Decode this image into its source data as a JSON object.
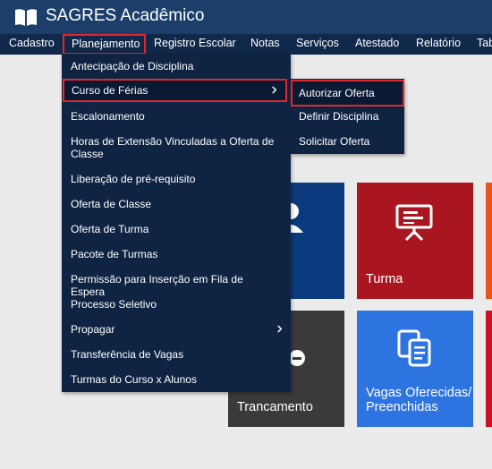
{
  "app": {
    "title": "SAGRES Acadêmico",
    "brand_color": "#1b3f6a"
  },
  "menubar": {
    "items": [
      {
        "label": "Cadastro"
      },
      {
        "label": "Planejamento",
        "highlighted": true
      },
      {
        "label": "Registro Escolar"
      },
      {
        "label": "Notas"
      },
      {
        "label": "Serviços"
      },
      {
        "label": "Atestado"
      },
      {
        "label": "Relatório"
      },
      {
        "label": "Tab"
      }
    ]
  },
  "dropdown": {
    "items": [
      {
        "label": "Antecipação de Disciplina"
      },
      {
        "label": "Curso de Férias",
        "has_submenu": true,
        "active": true
      },
      {
        "label": "Escalonamento"
      },
      {
        "label": "Horas de Extensão Vinculadas a Oferta de Classe"
      },
      {
        "label": "Liberação de pré-requisito"
      },
      {
        "label": "Oferta de Classe"
      },
      {
        "label": "Oferta de Turma"
      },
      {
        "label": "Pacote de Turmas"
      },
      {
        "label": "Permissão para Inserção em Fila de Espera"
      },
      {
        "label": "Processo Seletivo"
      },
      {
        "label": "Propagar",
        "has_submenu": true
      },
      {
        "label": "Transferência de Vagas"
      },
      {
        "label": "Turmas do Curso x Alunos"
      }
    ]
  },
  "submenu": {
    "items": [
      {
        "label": "Autorizar Oferta",
        "active": true
      },
      {
        "label": "Definir Disciplina"
      },
      {
        "label": "Solicitar Oferta"
      }
    ]
  },
  "tiles": [
    {
      "label": "",
      "color": "#0b3a7e",
      "icon": "user-icon"
    },
    {
      "label": "Turma",
      "color": "#aa1620",
      "icon": "presentation-board-icon"
    },
    {
      "label": "",
      "color": "#e8541a",
      "icon": ""
    },
    {
      "label": "Trancamento",
      "color": "#3a3a3a",
      "icon": "lock-icon"
    },
    {
      "label": "Vagas Oferecidas/ Preenchidas",
      "color": "#2e74e0",
      "icon": "documents-icon"
    },
    {
      "label": "",
      "color": "#cc1122",
      "icon": ""
    }
  ],
  "colors": {
    "highlight_border": "#e0262f",
    "menu_bg": "#10294a",
    "dropdown_bg": "#0f2443"
  }
}
